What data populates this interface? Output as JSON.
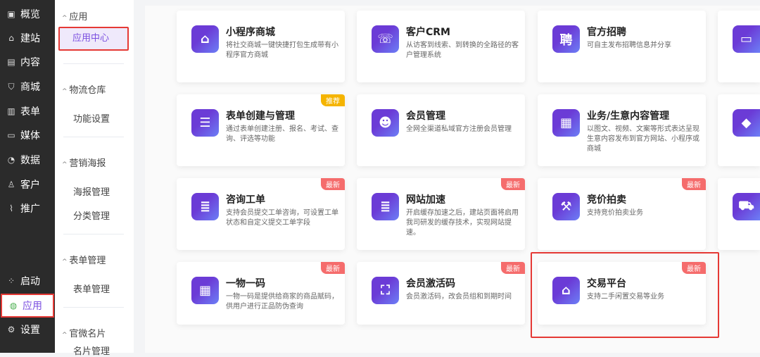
{
  "nav": {
    "items": [
      {
        "label": "概览",
        "icon": "dashboard-icon"
      },
      {
        "label": "建站",
        "icon": "home-icon"
      },
      {
        "label": "内容",
        "icon": "document-icon"
      },
      {
        "label": "商城",
        "icon": "cart-icon"
      },
      {
        "label": "表单",
        "icon": "form-icon"
      },
      {
        "label": "媒体",
        "icon": "video-icon"
      },
      {
        "label": "数据",
        "icon": "pie-chart-icon"
      },
      {
        "label": "客户",
        "icon": "user-icon"
      },
      {
        "label": "推广",
        "icon": "paperclip-icon"
      }
    ],
    "bottom": [
      {
        "label": "启动",
        "icon": "launch-icon"
      },
      {
        "label": "应用",
        "icon": "apps-icon"
      },
      {
        "label": "设置",
        "icon": "gear-icon"
      }
    ]
  },
  "submenu": {
    "groups": [
      {
        "title": "应用",
        "items": [
          "应用中心"
        ]
      },
      {
        "title": "物流仓库",
        "items": [
          "功能设置"
        ]
      },
      {
        "title": "营销海报",
        "items": [
          "海报管理",
          "分类管理"
        ]
      },
      {
        "title": "表单管理",
        "items": [
          "表单管理"
        ]
      },
      {
        "title": "官微名片",
        "items": [
          "名片管理"
        ]
      }
    ]
  },
  "cards": [
    {
      "title": "小程序商城",
      "desc": "将社交商城一键快捷打包生成带有小程序官方商城",
      "icon": "store-icon",
      "glyph": "⌂"
    },
    {
      "title": "客户CRM",
      "desc": "从访客到线索、到转换的全路径的客户管理系统",
      "icon": "crm-icon",
      "glyph": "☏"
    },
    {
      "title": "官方招聘",
      "desc": "可自主发布招聘信息并分享",
      "icon": "recruit-icon",
      "glyph": "聘"
    },
    {
      "title": "",
      "desc": "",
      "icon": "browser-icon",
      "glyph": "▭"
    },
    {
      "title": "表单创建与管理",
      "desc": "通过表单创建注册、报名、考试、查询、评选等功能",
      "icon": "clipboard-icon",
      "glyph": "☰",
      "badge": "推荐"
    },
    {
      "title": "会员管理",
      "desc": "全网全渠道私域官方注册会员管理",
      "icon": "member-icon",
      "glyph": "☻"
    },
    {
      "title": "业务/生意内容管理",
      "desc": "以图文、视频、文案等形式表达呈现生意内容发布到官方网站、小程序或商城",
      "icon": "content-icon",
      "glyph": "▦"
    },
    {
      "title": "",
      "desc": "",
      "icon": "diamond-icon",
      "glyph": "◆"
    },
    {
      "title": "咨询工单",
      "desc": "支持会员提交工单咨询，可设置工单状态和自定义提交工单字段",
      "icon": "ticket-icon",
      "glyph": "≣",
      "badge": "最新"
    },
    {
      "title": "网站加速",
      "desc": "开启缓存加速之后，建站页面将启用我司研发的缓存技术，实现网站提速。",
      "icon": "speed-icon",
      "glyph": "≣",
      "badge": "最新"
    },
    {
      "title": "竞价拍卖",
      "desc": "支持竞价拍卖业务",
      "icon": "gavel-icon",
      "glyph": "⚒",
      "badge": "最新"
    },
    {
      "title": "",
      "desc": "",
      "icon": "truck-icon",
      "glyph": "⛟"
    },
    {
      "title": "一物一码",
      "desc": "一物一码是提供给商家的商品赋码，供用户进行正品防伪查询",
      "icon": "qrcode-icon",
      "glyph": "▦",
      "badge": "最新"
    },
    {
      "title": "会员激活码",
      "desc": "会员激活码，改会员组和到期时间",
      "icon": "scan-icon",
      "glyph": "⛶",
      "badge": "最新"
    },
    {
      "title": "交易平台",
      "desc": "支持二手闲置交易等业务",
      "icon": "market-icon",
      "glyph": "⌂",
      "badge": "最新"
    }
  ]
}
